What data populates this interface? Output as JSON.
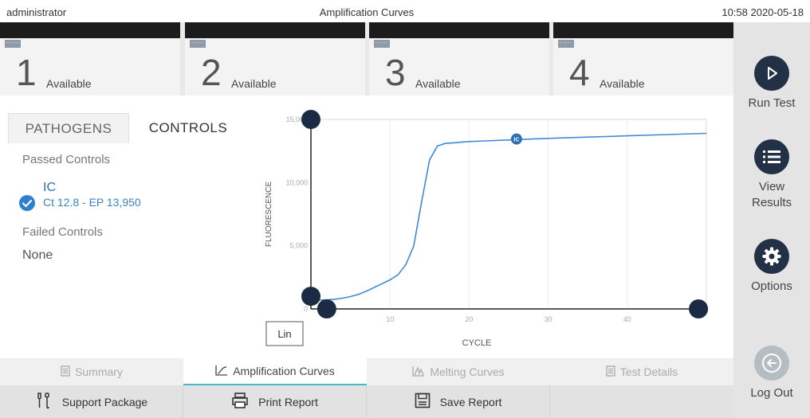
{
  "header": {
    "user": "administrator",
    "title": "Amplification Curves",
    "datetime": "10:58 2020-05-18"
  },
  "modules": [
    {
      "number": "1",
      "status": "Available",
      "tag": "--:--"
    },
    {
      "number": "2",
      "status": "Available",
      "tag": "--:--"
    },
    {
      "number": "3",
      "status": "Available",
      "tag": "--:--"
    },
    {
      "number": "4",
      "status": "Available",
      "tag": "--:--"
    }
  ],
  "sidebar": {
    "run_test": "Run Test",
    "view_results_1": "View",
    "view_results_2": "Results",
    "options": "Options",
    "log_out": "Log Out"
  },
  "tabs": {
    "pathogens": "PATHOGENS",
    "controls": "CONTROLS"
  },
  "controls": {
    "passed_label": "Passed Controls",
    "passed": [
      {
        "name": "IC",
        "detail": "Ct 12.8  -  EP 13,950"
      }
    ],
    "failed_label": "Failed Controls",
    "failed_value": "None"
  },
  "chart_data": {
    "type": "line",
    "xlabel": "CYCLE",
    "ylabel": "FLUORESCENCE",
    "xlim": [
      0,
      50
    ],
    "ylim": [
      0,
      15000
    ],
    "x_ticks": [
      "10",
      "20",
      "30",
      "40"
    ],
    "x_tick_values": [
      10,
      20,
      30,
      40
    ],
    "y_ticks": [
      "0",
      "5,000",
      "10,000",
      "15,000"
    ],
    "y_tick_values": [
      0,
      5000,
      10000,
      15000
    ],
    "scale_button": "Lin",
    "marker_label": "IC",
    "marker_point": {
      "x": 26,
      "y": 13450
    },
    "series": [
      {
        "name": "IC",
        "color": "#3d8ad8",
        "x": [
          1,
          2,
          3,
          4,
          5,
          6,
          7,
          8,
          9,
          10,
          11,
          12,
          13,
          14,
          15,
          16,
          17,
          18,
          19,
          20,
          22,
          24,
          26,
          28,
          30,
          35,
          40,
          45,
          50
        ],
        "y": [
          700,
          720,
          760,
          850,
          980,
          1150,
          1400,
          1700,
          2000,
          2300,
          2700,
          3500,
          5000,
          8500,
          11800,
          12900,
          13100,
          13150,
          13200,
          13250,
          13300,
          13350,
          13400,
          13450,
          13500,
          13600,
          13700,
          13800,
          13900
        ]
      }
    ],
    "threshold_handles": [
      {
        "x": 0,
        "y": 15000
      },
      {
        "x": 0,
        "y": 1000
      },
      {
        "x": 2,
        "y": 0
      },
      {
        "x": 49,
        "y": 0
      }
    ]
  },
  "bottom_tabs": [
    {
      "label": "Summary",
      "icon": "document-icon",
      "active": false
    },
    {
      "label": "Amplification Curves",
      "icon": "amplification-icon",
      "active": true
    },
    {
      "label": "Melting Curves",
      "icon": "melting-icon",
      "active": false
    },
    {
      "label": "Test Details",
      "icon": "document-icon",
      "active": false
    }
  ],
  "actions": {
    "support_package": "Support Package",
    "print_report": "Print Report",
    "save_report": "Save Report"
  }
}
